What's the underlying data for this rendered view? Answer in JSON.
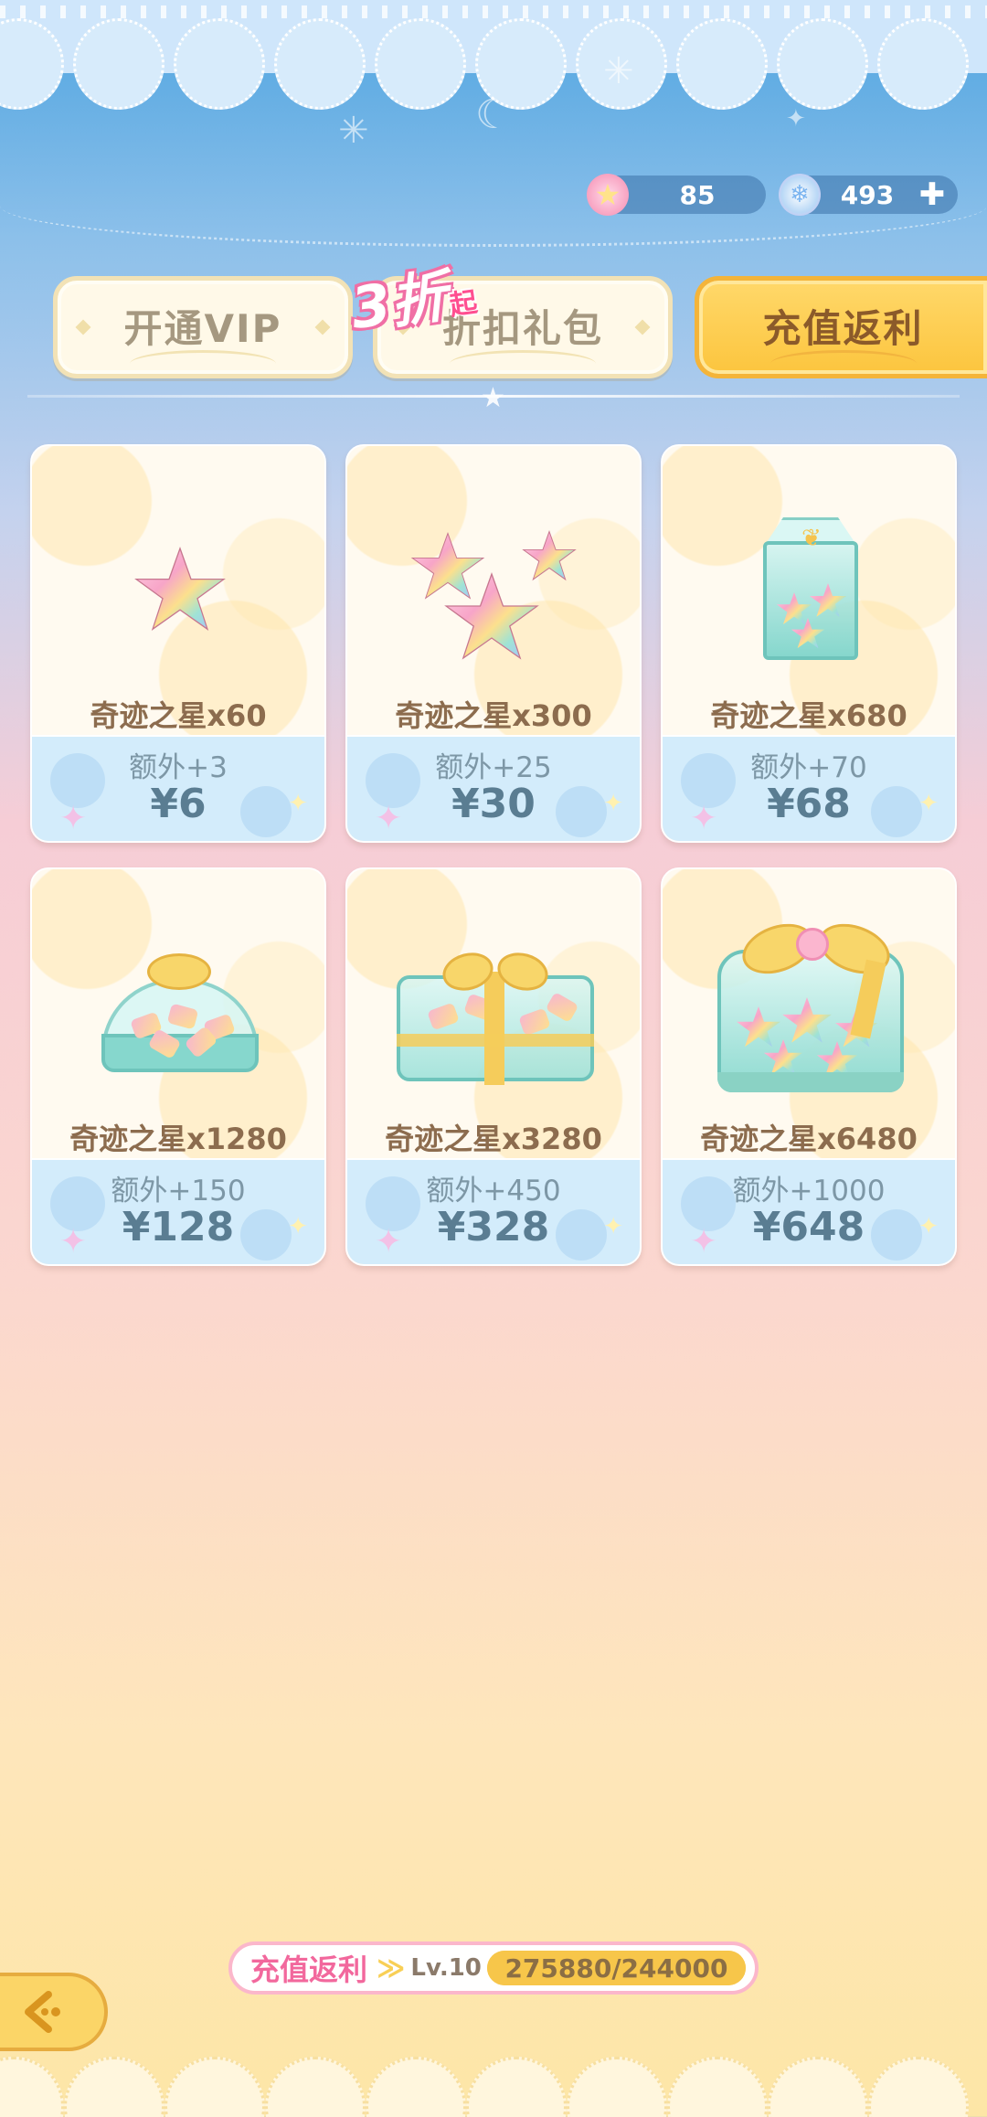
{
  "currency": {
    "miracle_star": "85",
    "crystal": "493",
    "add_icon": "plus-icon"
  },
  "tabs": [
    {
      "label": "开通VIP",
      "active": false
    },
    {
      "label": "折扣礼包",
      "active": false
    },
    {
      "label": "充值返利",
      "active": true
    }
  ],
  "discount_badge": {
    "number": "3折",
    "suffix": "起"
  },
  "products": [
    {
      "name": "奇迹之星x60",
      "bonus": "额外+3",
      "price": "¥6",
      "art": "single-star"
    },
    {
      "name": "奇迹之星x300",
      "bonus": "额外+25",
      "price": "¥30",
      "art": "three-stars"
    },
    {
      "name": "奇迹之星x680",
      "bonus": "额外+70",
      "price": "¥68",
      "art": "star-carton"
    },
    {
      "name": "奇迹之星x1280",
      "bonus": "额外+150",
      "price": "¥128",
      "art": "star-candy-box"
    },
    {
      "name": "奇迹之星x3280",
      "bonus": "额外+450",
      "price": "¥328",
      "art": "star-gift-box"
    },
    {
      "name": "奇迹之星x6480",
      "bonus": "额外+1000",
      "price": "¥648",
      "art": "star-bow-chest"
    }
  ],
  "rebate_progress": {
    "label": "充值返利",
    "level": "Lv.10",
    "progress_text": "275880/244000",
    "fill_fraction": 1.0
  },
  "colors": {
    "active_tab": "#fcc53e",
    "price_text": "#5a7d92",
    "rebate_label": "#f2689d"
  }
}
